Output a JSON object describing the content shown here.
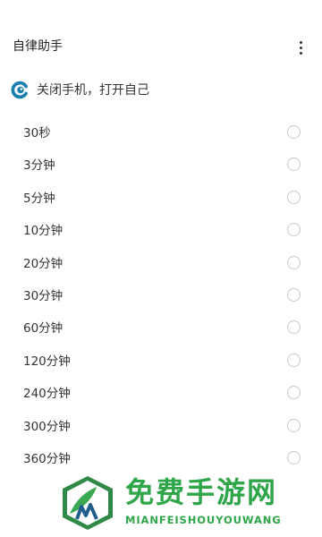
{
  "app": {
    "title": "自律助手",
    "subtitle": "关闭手机，打开自己"
  },
  "options": [
    {
      "label": "30秒",
      "selected": false
    },
    {
      "label": "3分钟",
      "selected": false
    },
    {
      "label": "5分钟",
      "selected": false
    },
    {
      "label": "10分钟",
      "selected": false
    },
    {
      "label": "20分钟",
      "selected": false
    },
    {
      "label": "30分钟",
      "selected": false
    },
    {
      "label": "60分钟",
      "selected": false
    },
    {
      "label": "120分钟",
      "selected": false
    },
    {
      "label": "240分钟",
      "selected": false
    },
    {
      "label": "300分钟",
      "selected": false
    },
    {
      "label": "360分钟",
      "selected": false
    }
  ],
  "watermark": {
    "title": "免费手游网",
    "subtitle": "MIANFEISHOUYOUWANG"
  },
  "colors": {
    "logo": "#1b7fb0",
    "watermark": "#2fa64a",
    "radio_border": "#c8c8c8"
  },
  "icons": {
    "more": "more-vert-icon",
    "logo": "app-logo-icon"
  }
}
